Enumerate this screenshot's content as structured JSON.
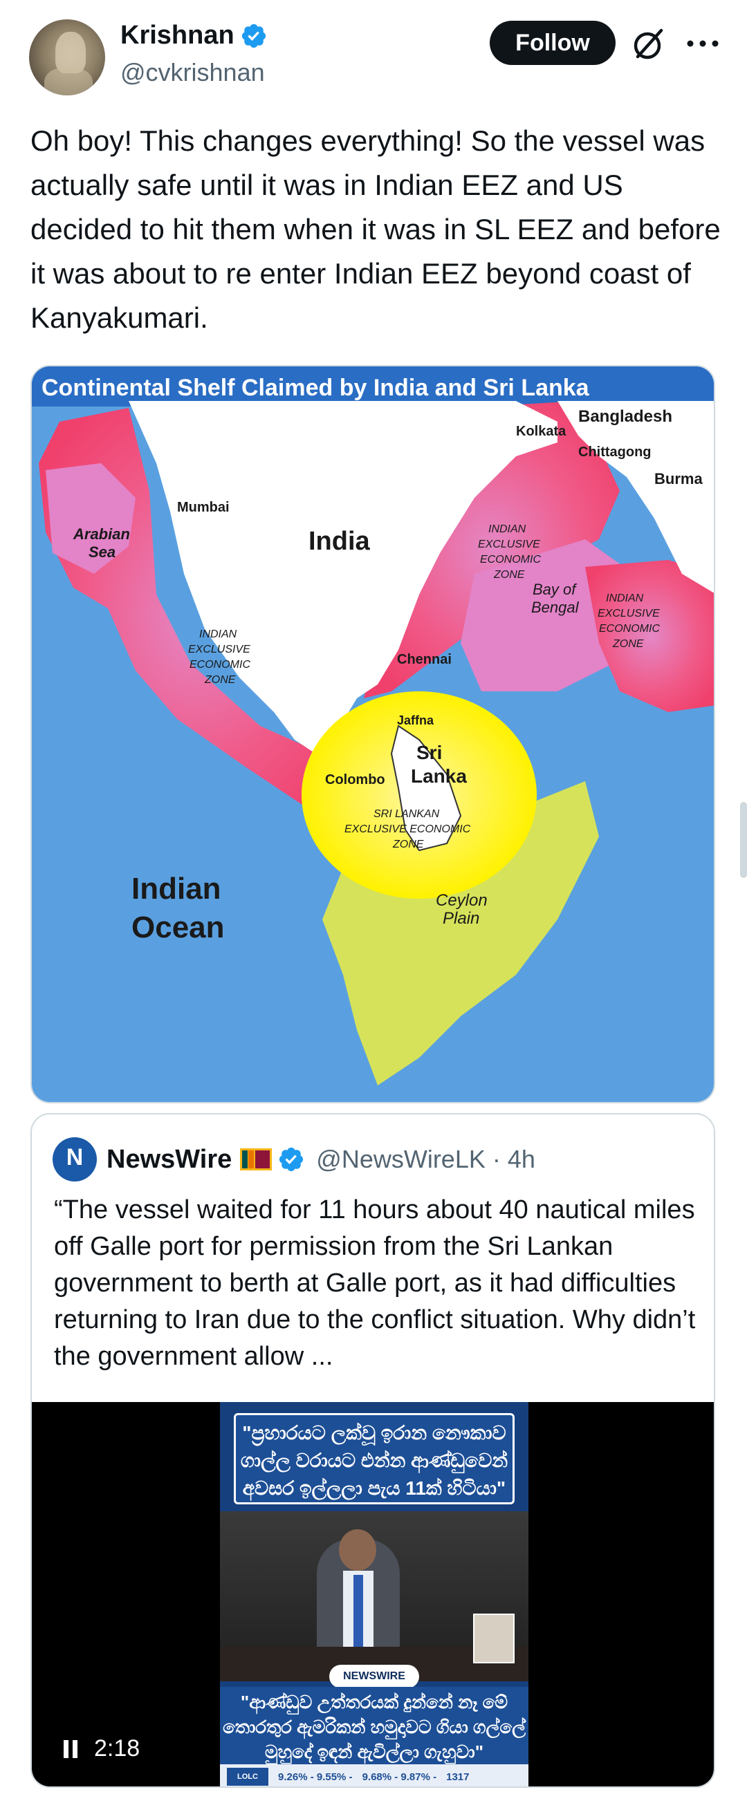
{
  "author": {
    "display_name": "Krishnan",
    "handle": "@cvkrishnan",
    "verified": true
  },
  "actions": {
    "follow_label": "Follow",
    "grok_icon": "grok-icon",
    "more_icon": "more-icon"
  },
  "tweet": {
    "text": "Oh boy! This changes everything! So the vessel was actually safe until it was in Indian EEZ and US decided to hit them when it was in SL EEZ and before it was about to re enter Indian EEZ beyond coast of Kanyakumari."
  },
  "map": {
    "title": "Continental Shelf Claimed by India and Sri Lanka",
    "labels": {
      "bangladesh": "Bangladesh",
      "kolkata": "Kolkata",
      "chittagong": "Chittagong",
      "burma": "Burma",
      "mumbai": "Mumbai",
      "arabian_sea_1": "Arabian",
      "arabian_sea_2": "Sea",
      "india": "India",
      "indian_eez_east_1": "INDIAN",
      "indian_eez_east_2": "EXCLUSIVE",
      "indian_eez_east_3": "ECONOMIC",
      "indian_eez_east_4": "ZONE",
      "bay_1": "Bay of",
      "bay_2": "Bengal",
      "indian_eez_far_1": "INDIAN",
      "indian_eez_far_2": "EXCLUSIVE",
      "indian_eez_far_3": "ECONOMIC",
      "indian_eez_far_4": "ZONE",
      "indian_eez_west_1": "INDIAN",
      "indian_eez_west_2": "EXCLUSIVE",
      "indian_eez_west_3": "ECONOMIC",
      "indian_eez_west_4": "ZONE",
      "chennai": "Chennai",
      "jaffna": "Jaffna",
      "sri": "Sri",
      "lanka": "Lanka",
      "colombo": "Colombo",
      "sl_eez_1": "SRI LANKAN",
      "sl_eez_2": "EXCLUSIVE ECONOMIC",
      "sl_eez_3": "ZONE",
      "ocean_1": "Indian",
      "ocean_2": "Ocean",
      "ceylon_1": "Ceylon",
      "ceylon_2": "Plain"
    },
    "colors": {
      "ocean": "#5aa0e0",
      "land": "#ffffff",
      "india_eez": "#f0507a",
      "india_claim": "#e383c8",
      "sl_eez": "#fff200",
      "sl_claim": "#d6e25a",
      "title_bar": "#2a6dc4"
    }
  },
  "quote": {
    "display_name": "NewsWire",
    "flag": "Sri Lanka flag",
    "handle": "@NewsWireLK",
    "separator": "·",
    "time": "4h",
    "avatar_letter": "N",
    "text": "“The vessel waited for 11 hours about 40 nautical miles off Galle port for permission from the Sri Lankan government to berth at Galle port, as it had difficulties returning to Iran due to the conflict situation. Why didn’t the government allow ..."
  },
  "video": {
    "duration": "2:18",
    "state_icon": "pause-icon",
    "banner_top": "\"ප්‍රහාරයට ලක්වූ ඉරාන නෞකාව ගාල්ල වරායට එන්න ආණ්ඩුවෙන් අවසර ඉල්ලලා පැය 11ක් හිටියා\"",
    "banner_bottom": "\"ආණ්ඩුව උත්තරයක් දුන්නේ නෑ මේ තොරතුර ඇමරිකන් හමුදාවට ගියා ගල්ලේ මුහුදේ ඉඳන් ඇවිල්ලා ගැහුවා\"",
    "logo": "NEWSWIRE",
    "ticker_brand": "LOLC FINANCE",
    "ticker_rate_1": "9.26% - 9.55% -",
    "ticker_rate_2": "9.68% - 9.87% -",
    "ticker_hotline": "1317"
  }
}
